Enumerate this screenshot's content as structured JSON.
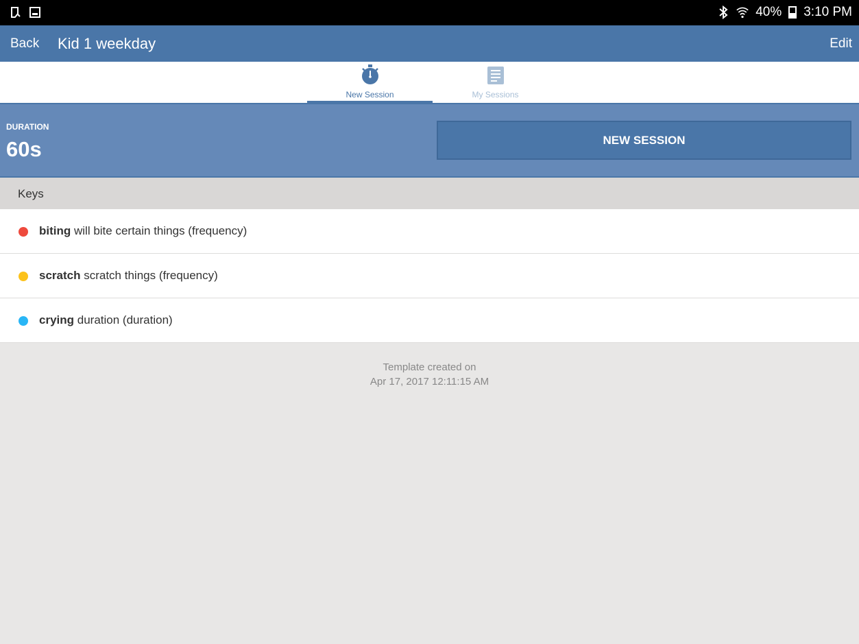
{
  "status": {
    "left_icons": [
      "clipboard-icon",
      "image-icon"
    ],
    "battery": "40%",
    "time": "3:10 PM"
  },
  "appbar": {
    "back_label": "Back",
    "title": "Kid 1 weekday",
    "edit_label": "Edit"
  },
  "tabs": [
    {
      "label": "New Session",
      "icon": "stopwatch-icon",
      "active": true
    },
    {
      "label": "My Sessions",
      "icon": "list-document-icon",
      "active": false
    }
  ],
  "duration": {
    "label": "DURATION",
    "value": "60s",
    "button_label": "NEW SESSION"
  },
  "keys": {
    "header": "Keys",
    "items": [
      {
        "name": "biting",
        "desc": "will bite certain things (frequency)",
        "color": "#ee4a3d"
      },
      {
        "name": "scratch",
        "desc": "scratch things (frequency)",
        "color": "#fcc21b"
      },
      {
        "name": "crying",
        "desc": "duration (duration)",
        "color": "#29b6f6"
      }
    ]
  },
  "footer": {
    "line1": "Template created on",
    "line2": "Apr 17, 2017 12:11:15 AM"
  },
  "colors": {
    "primary": "#4a76a8",
    "duration_bg": "#6589b8",
    "keys_header_bg": "#d9d7d6",
    "page_bg": "#e8e7e6"
  }
}
